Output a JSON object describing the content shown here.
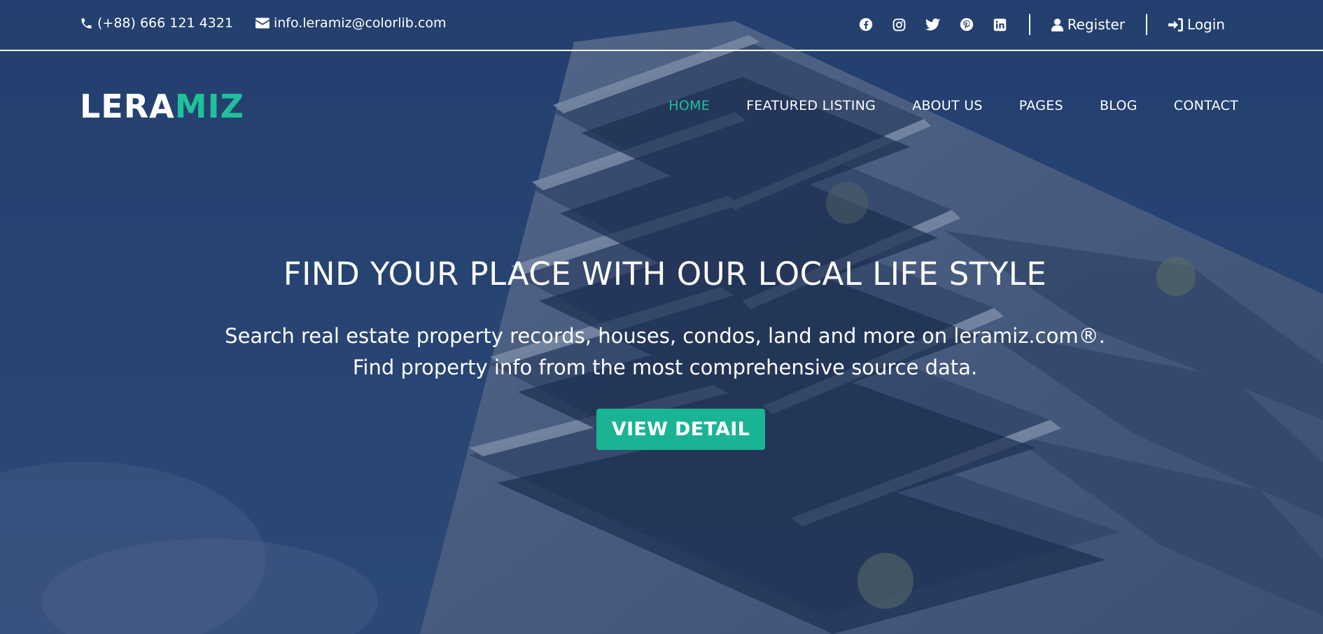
{
  "colors": {
    "accent": "#1ec19a",
    "button": "#1ab394",
    "text": "#ffffff",
    "overlay": "#1f3a66"
  },
  "top_bar": {
    "phone": "(+88) 666 121 4321",
    "email": "info.leramiz@colorlib.com",
    "social": [
      "facebook-icon",
      "instagram-icon",
      "twitter-icon",
      "pinterest-icon",
      "linkedin-icon"
    ],
    "register_label": "Register",
    "login_label": "Login"
  },
  "header": {
    "logo_part_a": "LERA",
    "logo_part_b": "MIZ",
    "nav": [
      {
        "label": "HOME",
        "active": true
      },
      {
        "label": "FEATURED LISTING",
        "active": false
      },
      {
        "label": "ABOUT US",
        "active": false
      },
      {
        "label": "PAGES",
        "active": false
      },
      {
        "label": "BLOG",
        "active": false
      },
      {
        "label": "CONTACT",
        "active": false
      }
    ]
  },
  "hero": {
    "title": "FIND YOUR PLACE WITH OUR LOCAL LIFE STYLE",
    "subtitle_line1": "Search real estate property records, houses, condos, land and more on leramiz.com®.",
    "subtitle_line2": "Find property info from the most comprehensive source data.",
    "cta_label": "VIEW DETAIL"
  }
}
